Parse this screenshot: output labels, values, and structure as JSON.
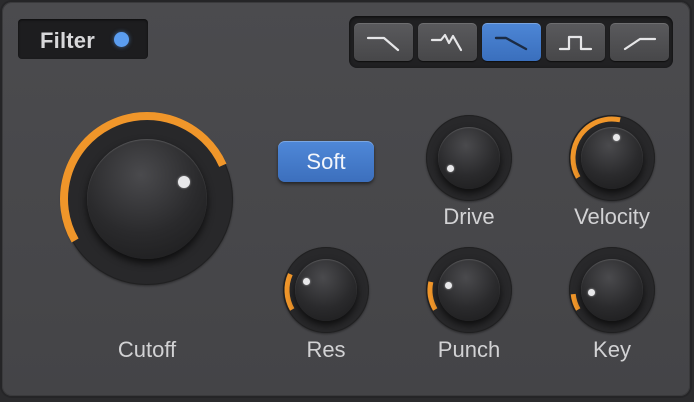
{
  "panel": {
    "title": "Filter",
    "power_led_color": "#5b9df0",
    "accent_color": "#f0962a"
  },
  "filter_types": [
    {
      "icon": "lowpass-filter-icon",
      "active": false
    },
    {
      "icon": "peak-lowpass-filter-icon",
      "active": false
    },
    {
      "icon": "gentle-lowpass-filter-icon",
      "active": true
    },
    {
      "icon": "bandpass-filter-icon",
      "active": false
    },
    {
      "icon": "highpass-filter-icon",
      "active": false
    }
  ],
  "soft_button": {
    "label": "Soft",
    "active": true
  },
  "knobs": {
    "cutoff": {
      "label": "Cutoff",
      "value_fraction": 0.62
    },
    "drive": {
      "label": "Drive",
      "value_fraction": 0.0
    },
    "velocity": {
      "label": "Velocity",
      "value_fraction": 0.44
    },
    "res": {
      "label": "Res",
      "value_fraction": 0.18
    },
    "punch": {
      "label": "Punch",
      "value_fraction": 0.14
    },
    "key": {
      "label": "Key",
      "value_fraction": 0.08
    }
  }
}
